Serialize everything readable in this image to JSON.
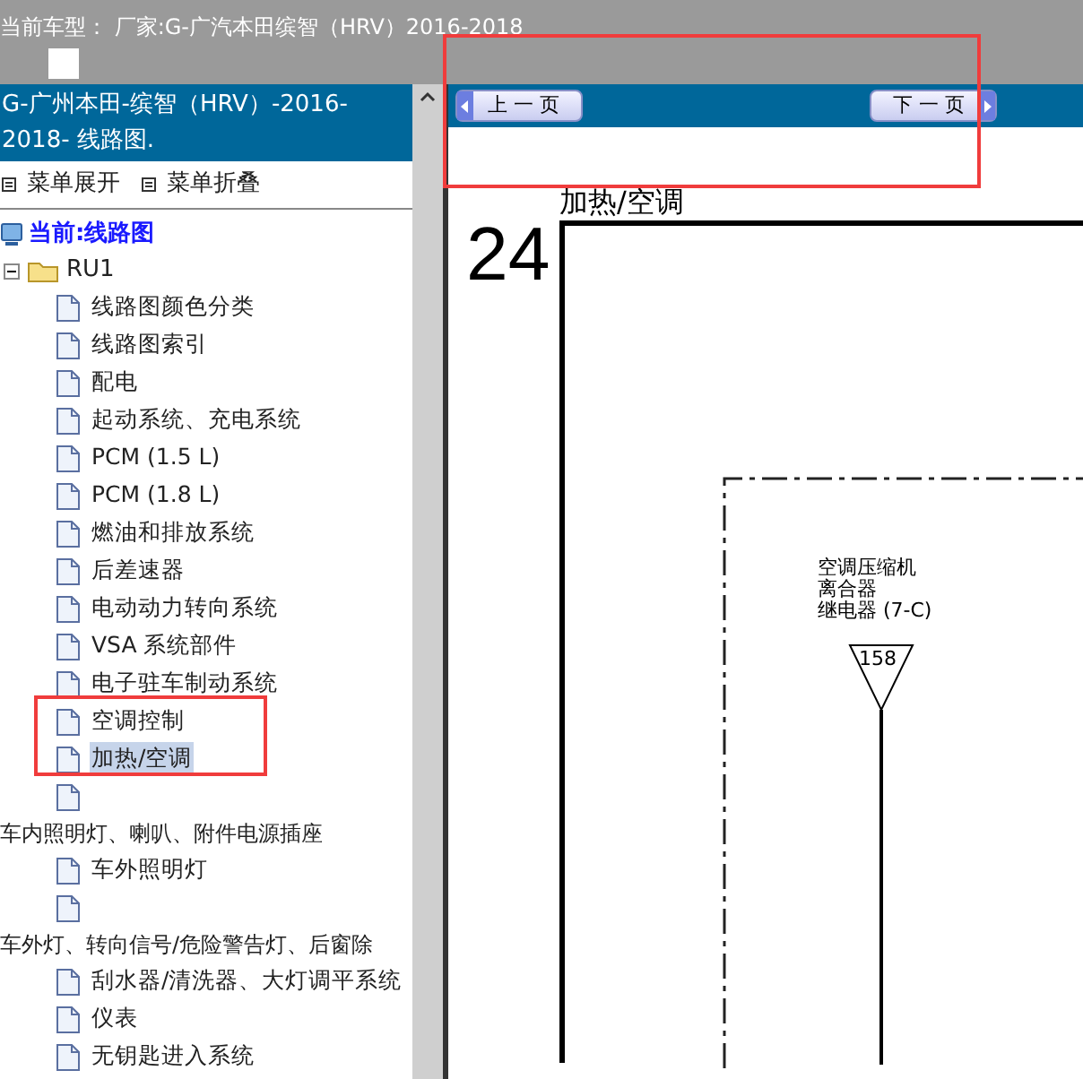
{
  "top_bar": {
    "text": "当前车型： 厂家:G-广汽本田缤智（HRV）2016-2018"
  },
  "sidebar": {
    "title": "G-广州本田-缤智（HRV）-2016-2018- 线路图.",
    "menu_actions": [
      "菜单展开",
      "菜单折叠"
    ],
    "tree": {
      "label": "当前:线路图",
      "children": [
        {
          "kind": "folder",
          "label": "RU1",
          "expanded": true,
          "children": [
            {
              "kind": "page",
              "label": "线路图颜色分类",
              "selected": false
            },
            {
              "kind": "page",
              "label": "线路图索引",
              "selected": false
            },
            {
              "kind": "page",
              "label": "配电",
              "selected": false
            },
            {
              "kind": "page",
              "label": "起动系统、充电系统",
              "selected": false
            },
            {
              "kind": "page",
              "label": "PCM (1.5 L)",
              "selected": false
            },
            {
              "kind": "page",
              "label": "PCM (1.8 L)",
              "selected": false
            },
            {
              "kind": "page",
              "label": "燃油和排放系统",
              "selected": false
            },
            {
              "kind": "page",
              "label": "后差速器",
              "selected": false
            },
            {
              "kind": "page",
              "label": "电动动力转向系统",
              "selected": false
            },
            {
              "kind": "page",
              "label": "VSA 系统部件",
              "selected": false
            },
            {
              "kind": "page",
              "label": "电子驻车制动系统",
              "selected": false
            },
            {
              "kind": "page",
              "label": "空调控制",
              "selected": false
            },
            {
              "kind": "page",
              "label": "加热/空调",
              "selected": true
            },
            {
              "kind": "page",
              "selected": false
            },
            {
              "kind": "group",
              "label": "车内照明灯、喇叭、附件电源插座",
              "children": [
                {
                  "kind": "page",
                  "label": "车外照明灯",
                  "selected": false
                },
                {
                  "kind": "page",
                  "selected": false
                }
              ]
            },
            {
              "kind": "group",
              "label": "车外灯、转向信号/危险警告灯、后窗除",
              "children": [
                {
                  "kind": "page",
                  "label": "刮水器/清洗器、大灯调平系统",
                  "selected": false
                },
                {
                  "kind": "page",
                  "label": "仪表",
                  "selected": false
                },
                {
                  "kind": "page",
                  "label": "无钥匙进入系统",
                  "selected": false
                }
              ]
            }
          ]
        }
      ]
    }
  },
  "page_nav": {
    "prev": "上 一 页",
    "next": "下 一 页"
  },
  "diagram": {
    "page_number": "24",
    "title": "加热/空调",
    "component_label": [
      "空调压缩机",
      "离合器",
      "继电器 (7-C)"
    ],
    "terminal": "158"
  }
}
